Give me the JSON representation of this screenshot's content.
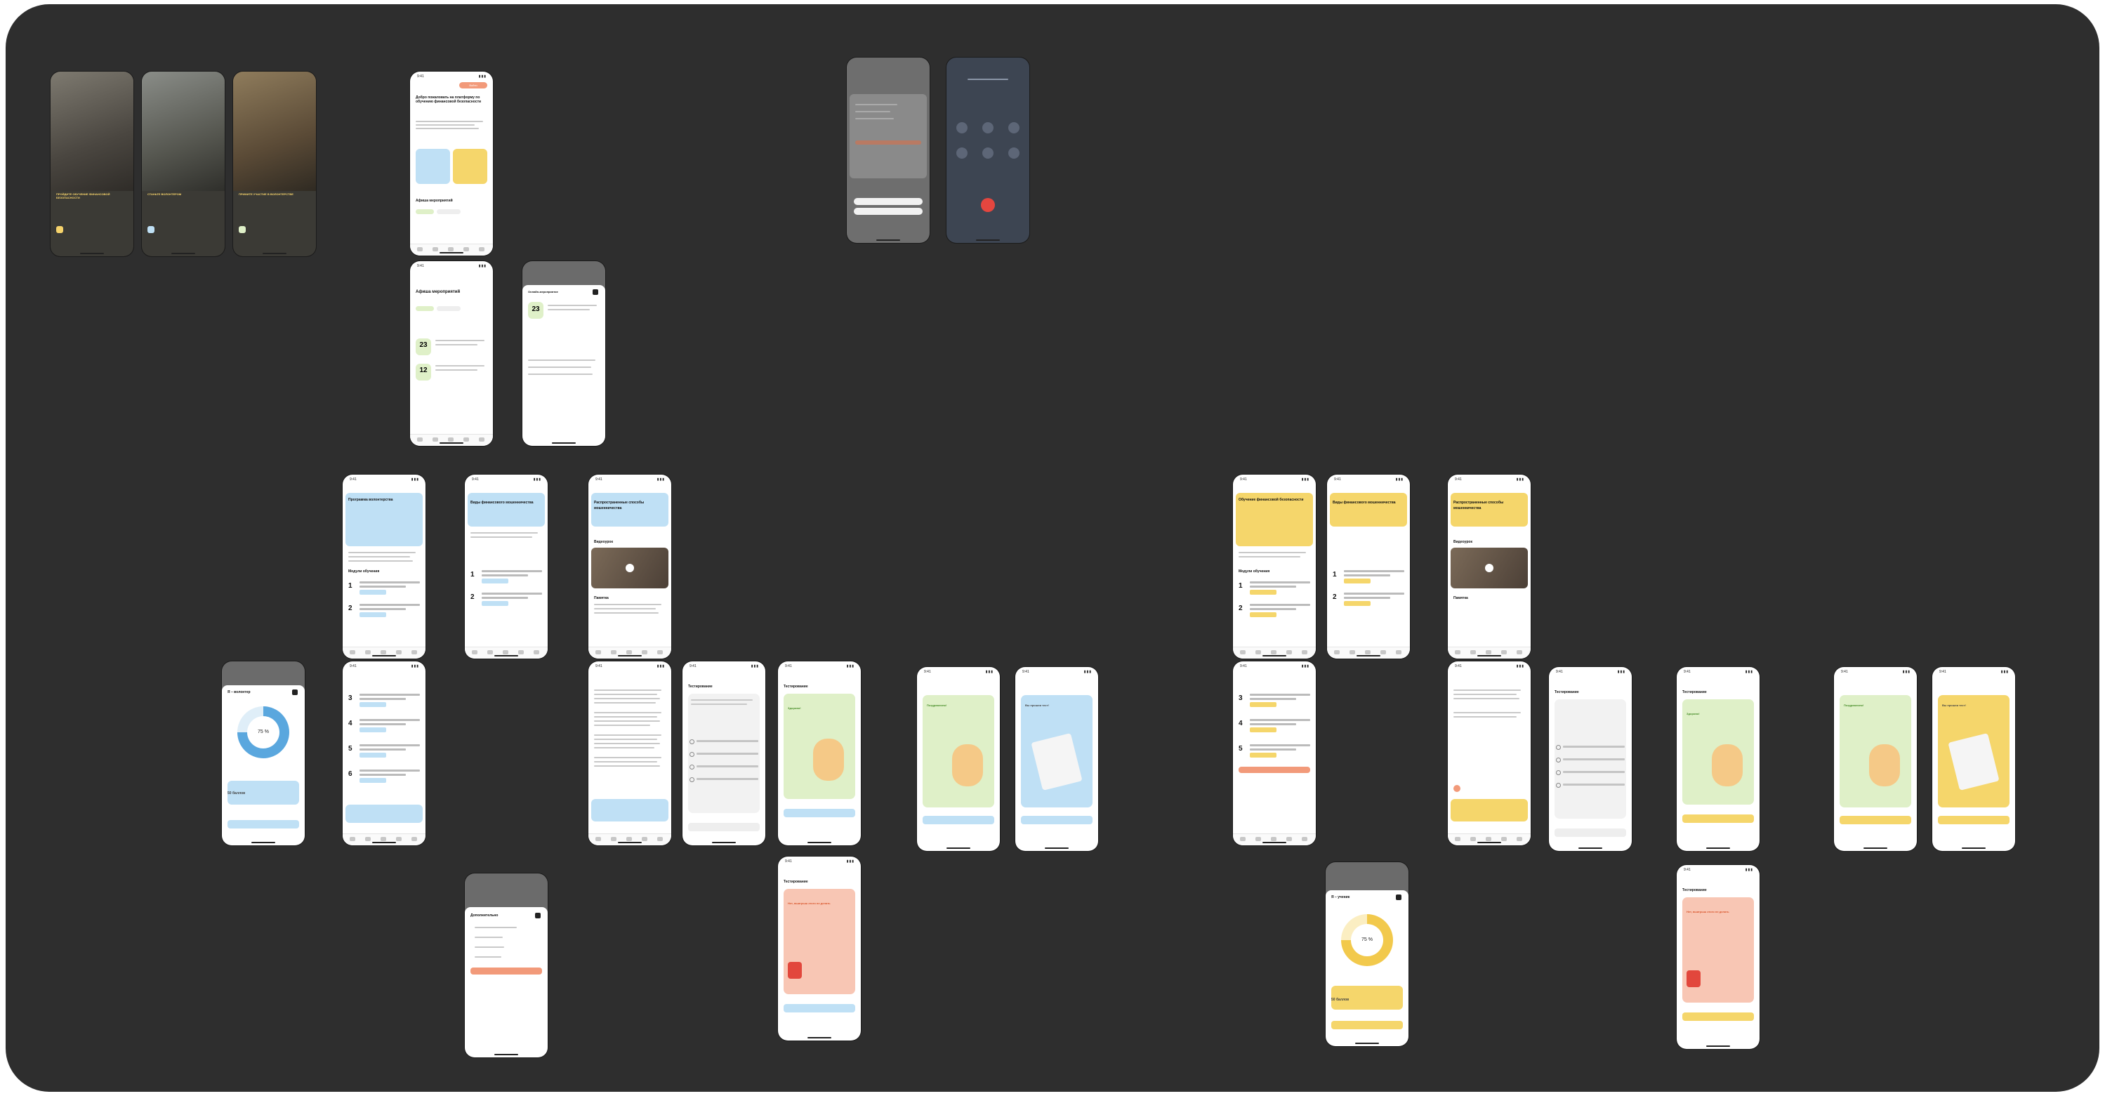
{
  "canvas": {
    "title": ""
  },
  "colors": {
    "board": "#2e2e2e",
    "phone": "#ffffff",
    "yellow": "#f5d66b",
    "blue": "#bfe0f5",
    "green": "#dff0c8",
    "salmon": "#f8c6b4",
    "orange_btn": "#f29a7a",
    "dark": "#2b2b2b"
  },
  "promo": [
    {
      "caption": "ПРОЙДИТЕ ОБУЧЕНИЕ ФИНАНСОВОЙ БЕЗОПАСНОСТИ"
    },
    {
      "caption": "СТАНЬТЕ ВОЛОНТЕРОМ"
    },
    {
      "caption": "ПРИМИТЕ УЧАСТИЕ В ВОЛОНТЕРСТВЕ"
    }
  ],
  "welcome": {
    "top_button": "Войти",
    "title": "Добро пожаловать на платформу по обучению финансовой безопасности",
    "events_heading": "Афиша мероприятий"
  },
  "events": {
    "title": "Афиша мероприятий",
    "dates": [
      {
        "day": "23"
      },
      {
        "day": "12"
      }
    ]
  },
  "event_modal": {
    "title": "Онлайн-мероприятие",
    "day": "23"
  },
  "more_menu": {
    "title": "Дополнительно"
  },
  "call": {
    "icon_labels": [
      "mute",
      "keypad",
      "speaker",
      "add",
      "video",
      "contacts"
    ]
  },
  "volunteer": {
    "title": "Программа волонтерства",
    "modules_heading": "Модули обучения"
  },
  "module_page": {
    "title": "Виды финансового мошенничества"
  },
  "lesson": {
    "title": "Распространенные способы мошенничества",
    "video_heading": "Видеоурок",
    "memo_heading": "Памятка"
  },
  "progress_volunteer": {
    "title": "Я – волонтер",
    "percent": "75 %",
    "points": "50 баллов",
    "value": 75
  },
  "progress_student": {
    "title": "Я – ученик",
    "percent": "75 %",
    "points": "50 баллов",
    "value": 75
  },
  "test": {
    "title": "Тестирование",
    "correct": "Здорово!",
    "congrats": "Поздравляем!",
    "passed": "Вы прошли тест!",
    "wrong": "Нет, выигрыш этого не делать"
  },
  "finance": {
    "title": "Обучение финансовой безопасности",
    "modules_heading": "Модули обучения"
  }
}
